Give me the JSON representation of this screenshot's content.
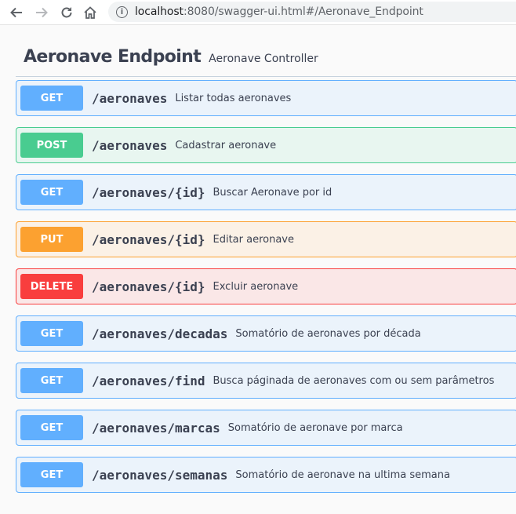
{
  "browser": {
    "url_host": "localhost",
    "url_rest": ":8080/swagger-ui.html#/Aeronave_Endpoint"
  },
  "tag": {
    "name": "Aeronave Endpoint",
    "description": "Aeronave Controller"
  },
  "operations": [
    {
      "method": "GET",
      "path": "/aeronaves",
      "summary": "Listar todas aeronaves"
    },
    {
      "method": "POST",
      "path": "/aeronaves",
      "summary": "Cadastrar aeronave"
    },
    {
      "method": "GET",
      "path": "/aeronaves/{id}",
      "summary": "Buscar Aeronave por id"
    },
    {
      "method": "PUT",
      "path": "/aeronaves/{id}",
      "summary": "Editar aeronave"
    },
    {
      "method": "DELETE",
      "path": "/aeronaves/{id}",
      "summary": "Excluir aeronave"
    },
    {
      "method": "GET",
      "path": "/aeronaves/decadas",
      "summary": "Somatório de aeronaves por década"
    },
    {
      "method": "GET",
      "path": "/aeronaves/find",
      "summary": "Busca páginada de aeronaves com ou sem parâmetros"
    },
    {
      "method": "GET",
      "path": "/aeronaves/marcas",
      "summary": "Somatório de aeronave por marca"
    },
    {
      "method": "GET",
      "path": "/aeronaves/semanas",
      "summary": "Somatório de aeronave na ultima semana"
    }
  ],
  "colors": {
    "get": "#61affe",
    "post": "#49cc90",
    "put": "#fca130",
    "delete": "#f93e3e"
  }
}
